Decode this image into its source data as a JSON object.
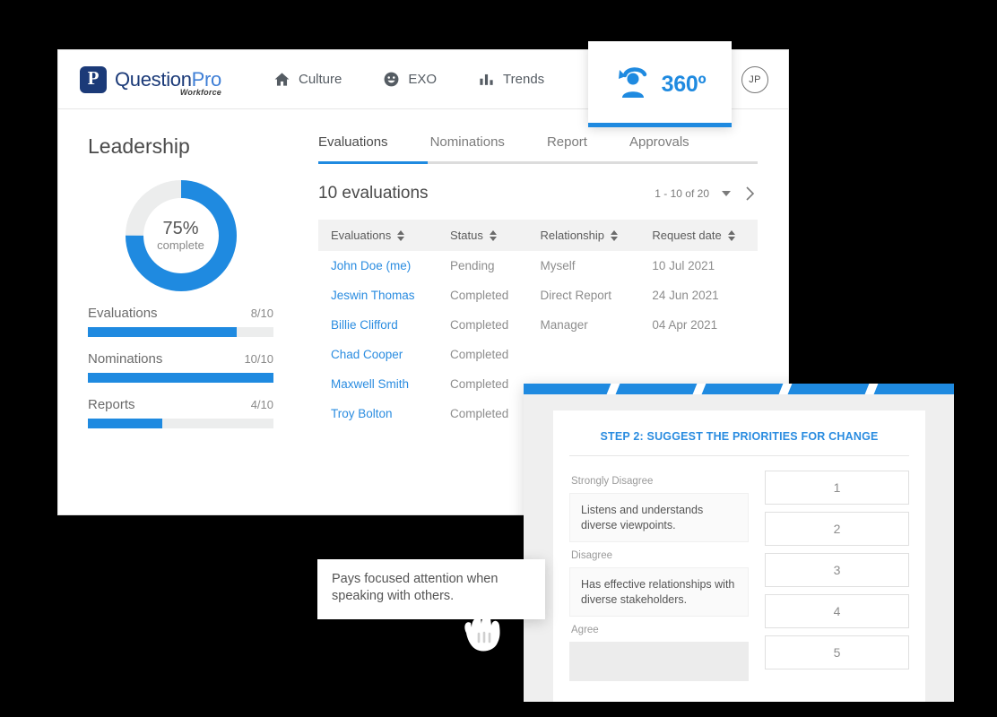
{
  "brand": {
    "logo_main": "Question",
    "logo_accent": "Pro",
    "logo_sub": "Workforce",
    "logo_mark_glyph": "P",
    "accent_color": "#1f8ae0",
    "navy_color": "#1b3a78"
  },
  "header": {
    "nav": [
      {
        "label": "Culture",
        "icon": "home-icon"
      },
      {
        "label": "EXO",
        "icon": "smiley-icon"
      },
      {
        "label": "Trends",
        "icon": "bar-chart-icon"
      }
    ],
    "active_module": {
      "label": "360º",
      "icon": "person-rotate-icon"
    },
    "avatar_initials": "JP"
  },
  "left_pane": {
    "title": "Leadership",
    "donut": {
      "percent": 75,
      "percent_label": "75%",
      "caption": "complete"
    },
    "progress": [
      {
        "name": "Evaluations",
        "value_label": "8/10",
        "value": 8,
        "max": 10
      },
      {
        "name": "Nominations",
        "value_label": "10/10",
        "value": 10,
        "max": 10
      },
      {
        "name": "Reports",
        "value_label": "4/10",
        "value": 4,
        "max": 10
      }
    ]
  },
  "main": {
    "tabs": [
      {
        "label": "Evaluations",
        "active": true
      },
      {
        "label": "Nominations",
        "active": false
      },
      {
        "label": "Report",
        "active": false
      },
      {
        "label": "Approvals",
        "active": false
      }
    ],
    "count_label": "10 evaluations",
    "pager_range": "1 - 10 of 20",
    "table": {
      "columns": [
        "Evaluations",
        "Status",
        "Relationship",
        "Request date"
      ],
      "rows": [
        {
          "name": "John Doe (me)",
          "status": "Pending",
          "relationship": "Myself",
          "date": "10 Jul 2021"
        },
        {
          "name": "Jeswin Thomas",
          "status": "Completed",
          "relationship": "Direct Report",
          "date": "24 Jun 2021"
        },
        {
          "name": "Billie Clifford",
          "status": "Completed",
          "relationship": "Manager",
          "date": "04 Apr 2021"
        },
        {
          "name": "Chad Cooper",
          "status": "Completed",
          "relationship": "",
          "date": ""
        },
        {
          "name": "Maxwell Smith",
          "status": "Completed",
          "relationship": "",
          "date": ""
        },
        {
          "name": "Troy Bolton",
          "status": "Completed",
          "relationship": "",
          "date": ""
        }
      ]
    }
  },
  "survey": {
    "step_title": "STEP 2: SUGGEST THE PRIORITIES FOR CHANGE",
    "steps_total": 5,
    "buckets": [
      {
        "label": "Strongly Disagree",
        "item": "Listens and understands diverse viewpoints.",
        "empty": false
      },
      {
        "label": "Disagree",
        "item": "Has effective relationships with diverse stakeholders.",
        "empty": false
      },
      {
        "label": "Agree",
        "item": "",
        "empty": true
      }
    ],
    "rating_options": [
      "1",
      "2",
      "3",
      "4",
      "5"
    ]
  },
  "drag_card": {
    "text": "Pays focused attention when speaking with others.",
    "cursor": "grabbing-hand-cursor"
  }
}
